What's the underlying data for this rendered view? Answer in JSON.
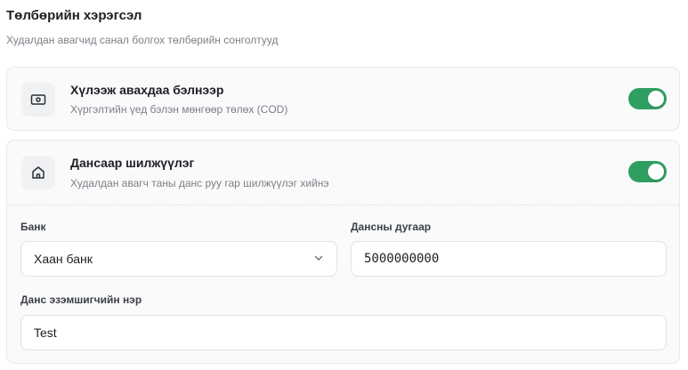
{
  "section": {
    "title": "Төлбөрийн хэрэгсэл",
    "subtitle": "Худалдан авагчид санал болгох төлбөрийн сонголтууд"
  },
  "options": {
    "cod": {
      "title": "Хүлээж авахдаа бэлнээр",
      "description": "Хүргэлтийн үед бэлэн мөнгөөр төлөх (COD)",
      "icon": "cash-icon",
      "enabled": true
    },
    "bank_transfer": {
      "title": "Дансаар шилжүүлэг",
      "description": "Худалдан авагч таны данс руу гар шилжүүлэг хийнэ",
      "icon": "bank-icon",
      "enabled": true
    }
  },
  "bank_form": {
    "bank_label": "Банк",
    "bank_value": "Хаан банк",
    "account_label": "Дансны дугаар",
    "account_value": "5000000000",
    "holder_label": "Данс эзэмшигчийн нэр",
    "holder_value": "Test"
  },
  "colors": {
    "toggle_on": "#2f9e61",
    "card_bg": "#fafafb",
    "border": "#e7e9ec"
  }
}
